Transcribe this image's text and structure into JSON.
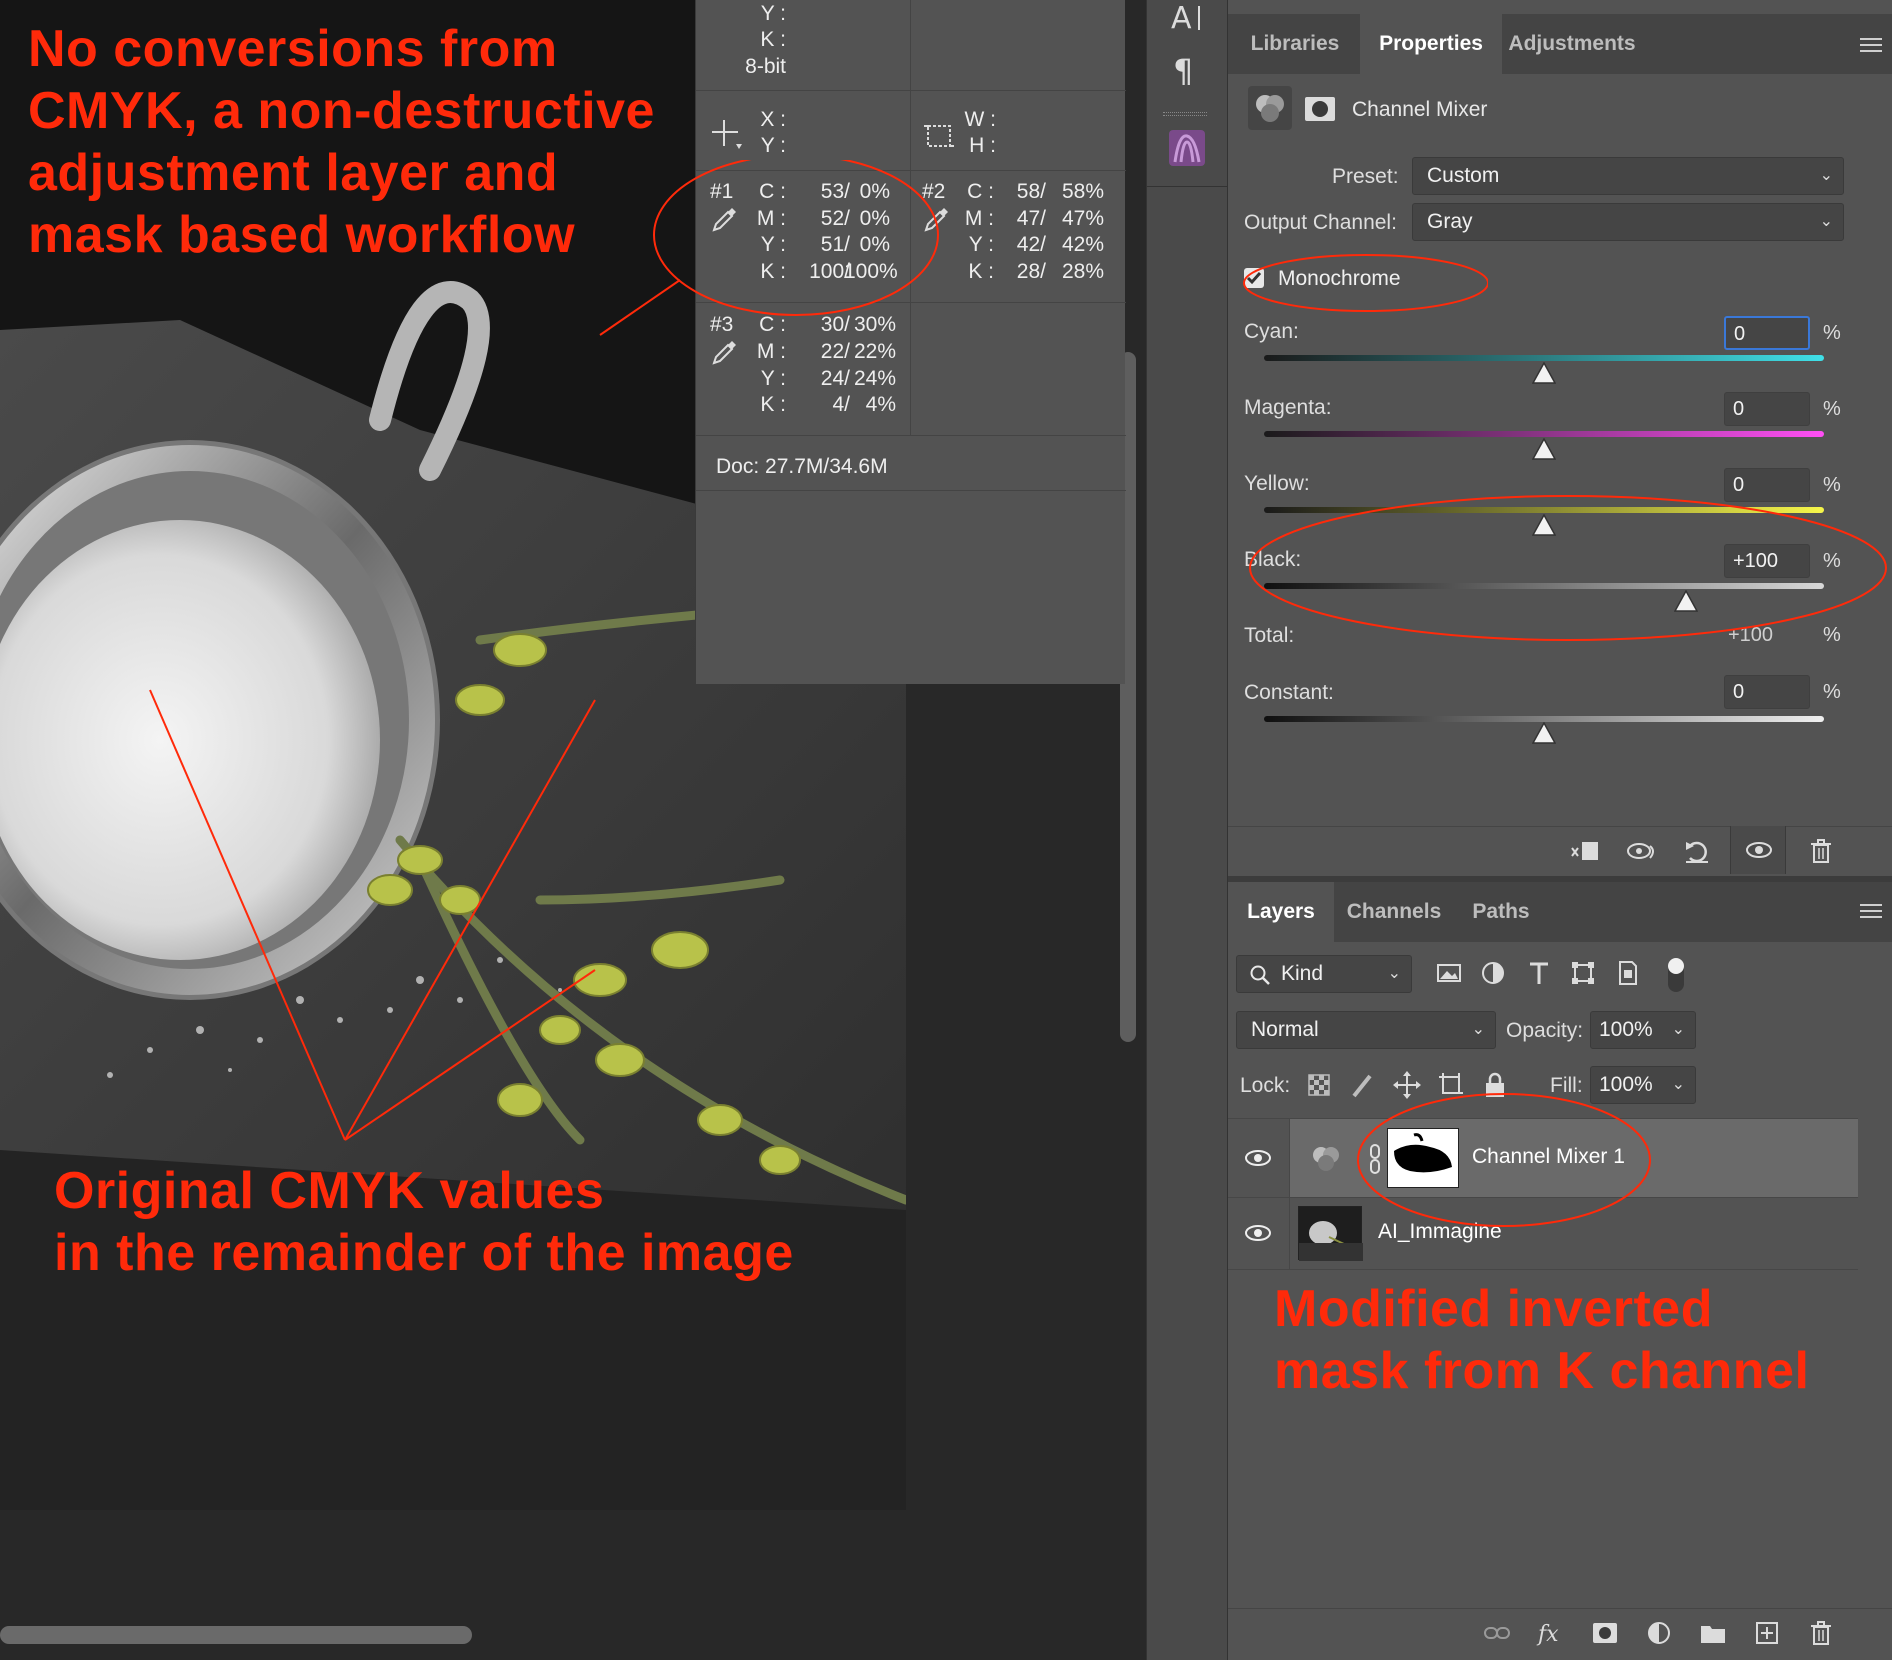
{
  "annotations": {
    "top_left_lines": [
      "No conversions from",
      "CMYK, a non-destructive",
      "adjustment layer and",
      "mask based workflow"
    ],
    "bottom_lines": [
      "Original CMYK values",
      "in the remainder of the image"
    ],
    "right_lines": [
      "Modified inverted",
      "mask from K channel"
    ],
    "color": "#ff2a0a"
  },
  "info_panel": {
    "top_labels": {
      "y": "Y :",
      "k": "K :",
      "bit_depth": "8-bit"
    },
    "xy": {
      "x": "X :",
      "y": "Y :"
    },
    "wh": {
      "w": "W :",
      "h": "H :"
    },
    "samplers": [
      {
        "id": "#1",
        "rows": [
          {
            "ch": "C :",
            "a": "53/",
            "b": "0%"
          },
          {
            "ch": "M :",
            "a": "52/",
            "b": "0%"
          },
          {
            "ch": "Y :",
            "a": "51/",
            "b": "0%"
          },
          {
            "ch": "K :",
            "a": "100/",
            "b": "100%"
          }
        ]
      },
      {
        "id": "#2",
        "rows": [
          {
            "ch": "C :",
            "a": "58/",
            "b": "58%"
          },
          {
            "ch": "M :",
            "a": "47/",
            "b": "47%"
          },
          {
            "ch": "Y :",
            "a": "42/",
            "b": "42%"
          },
          {
            "ch": "K :",
            "a": "28/",
            "b": "28%"
          }
        ]
      },
      {
        "id": "#3",
        "rows": [
          {
            "ch": "C :",
            "a": "30/",
            "b": "30%"
          },
          {
            "ch": "M :",
            "a": "22/",
            "b": "22%"
          },
          {
            "ch": "Y :",
            "a": "24/",
            "b": "24%"
          },
          {
            "ch": "K :",
            "a": "4/",
            "b": "4%"
          }
        ]
      }
    ],
    "doc": "Doc: 27.7M/34.6M"
  },
  "properties_panel": {
    "tabs": [
      "Libraries",
      "Properties",
      "Adjustments"
    ],
    "active_tab": "Properties",
    "title": "Channel Mixer",
    "preset_label": "Preset:",
    "preset_value": "Custom",
    "output_label": "Output Channel:",
    "output_value": "Gray",
    "monochrome_label": "Monochrome",
    "monochrome_checked": true,
    "sliders": [
      {
        "label": "Cyan:",
        "value": "0",
        "position": 0.5,
        "gradient": [
          "#1a1a1a",
          "#40e0e8"
        ]
      },
      {
        "label": "Magenta:",
        "value": "0",
        "position": 0.5,
        "gradient": [
          "#1a1a1a",
          "#ff4ff5"
        ]
      },
      {
        "label": "Yellow:",
        "value": "0",
        "position": 0.5,
        "gradient": [
          "#1a1a1a",
          "#f6f64a"
        ]
      },
      {
        "label": "Black:",
        "value": "+100",
        "position": 0.75,
        "gradient": [
          "#0f0f0f",
          "#d8d8d8"
        ]
      }
    ],
    "total_label": "Total:",
    "total_value": "+100",
    "constant_label": "Constant:",
    "constant_value": "0",
    "constant_position": 0.5,
    "pct": "%"
  },
  "layers_panel": {
    "tabs": [
      "Layers",
      "Channels",
      "Paths"
    ],
    "active_tab": "Layers",
    "filter_label": "Kind",
    "blend_mode": "Normal",
    "opacity_label": "Opacity:",
    "opacity_value": "100%",
    "lock_label": "Lock:",
    "fill_label": "Fill:",
    "fill_value": "100%",
    "layers": [
      {
        "name": "Channel Mixer 1",
        "visible": true,
        "selected": true
      },
      {
        "name": "AI_Immagine",
        "visible": true,
        "selected": false
      }
    ]
  }
}
